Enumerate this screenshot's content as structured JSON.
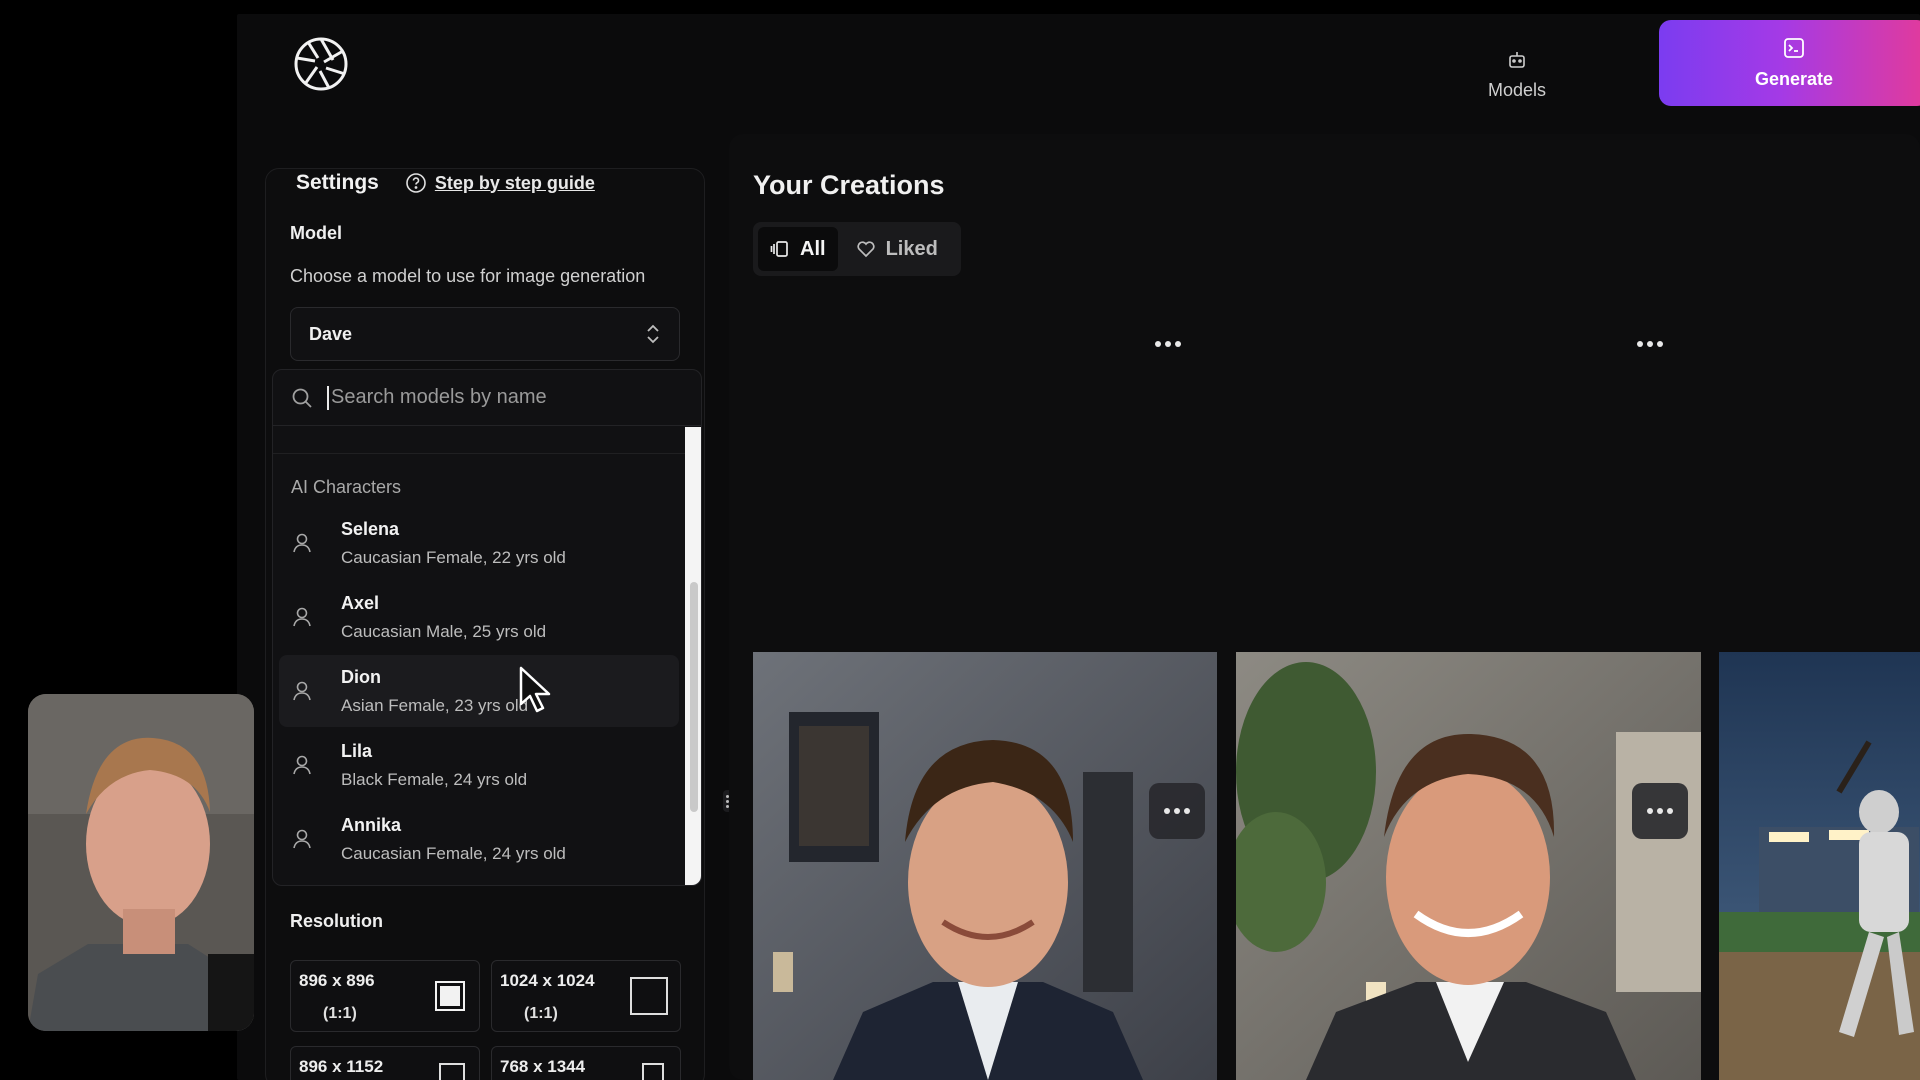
{
  "topbar": {
    "models_label": "Models",
    "generate_label": "Generate",
    "models_icon": "robot-icon",
    "generate_icon": "terminal-square-icon"
  },
  "settings": {
    "title": "Settings",
    "guide_link": "Step by step guide",
    "model_label": "Model",
    "model_description": "Choose a model to use for image generation",
    "selected_model": "Dave",
    "search_placeholder": "Search models by name",
    "group_label": "AI Characters",
    "characters": [
      {
        "name": "Selena",
        "description": "Caucasian Female, 22 yrs old"
      },
      {
        "name": "Axel",
        "description": "Caucasian Male, 25 yrs old"
      },
      {
        "name": "Dion",
        "description": "Asian Female, 23 yrs old"
      },
      {
        "name": "Lila",
        "description": "Black Female, 24 yrs old"
      },
      {
        "name": "Annika",
        "description": "Caucasian Female, 24 yrs old"
      }
    ],
    "hovered_character": "Dion",
    "resolution_label": "Resolution",
    "resolutions": [
      {
        "size": "896 x 896",
        "ratio": "(1:1)",
        "selected": true
      },
      {
        "size": "1024 x 1024",
        "ratio": "(1:1)",
        "selected": false
      },
      {
        "size": "896 x 1152",
        "ratio": "",
        "selected": false
      },
      {
        "size": "768 x 1344",
        "ratio": "",
        "selected": false
      }
    ]
  },
  "creations": {
    "title": "Your Creations",
    "filters": [
      {
        "label": "All",
        "active": true,
        "icon": "gallery-icon"
      },
      {
        "label": "Liked",
        "active": false,
        "icon": "heart-icon"
      }
    ]
  },
  "colors": {
    "accent_gradient_start": "#7b3cf0",
    "accent_gradient_end": "#e33a9a",
    "background": "#0b0b0c"
  }
}
